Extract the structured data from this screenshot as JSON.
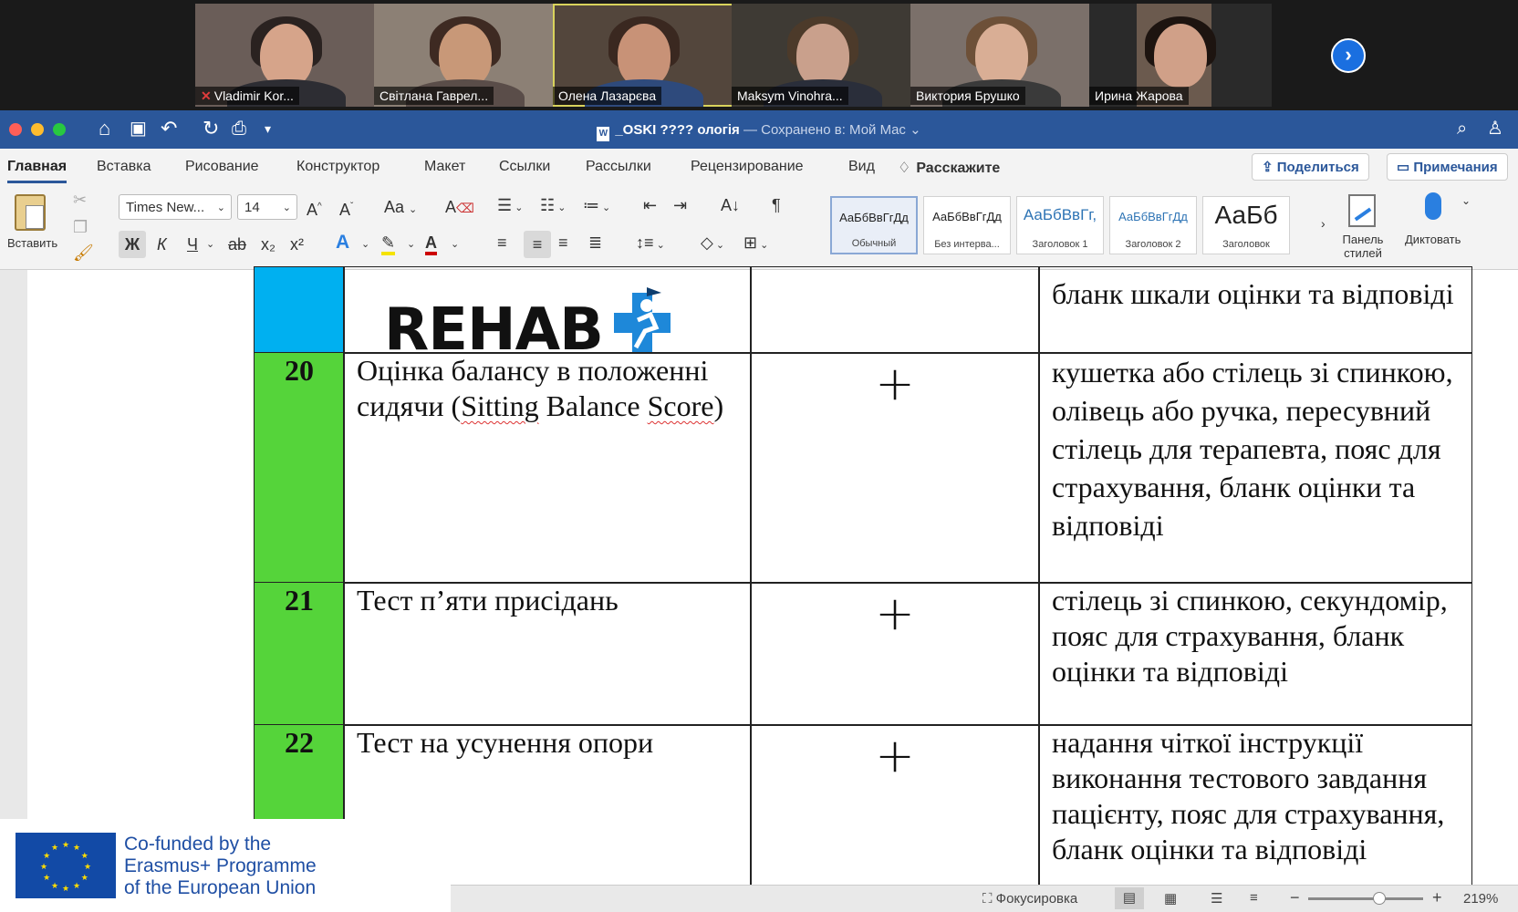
{
  "participants": [
    {
      "name": "Vladimir Kor...",
      "muted": true
    },
    {
      "name": "Світлана Гаврел...",
      "muted": false
    },
    {
      "name": "Олена Лазарєва",
      "muted": false,
      "active": true
    },
    {
      "name": "Maksym Vinohra...",
      "muted": false
    },
    {
      "name": "Виктория Брушко",
      "muted": false
    },
    {
      "name": "Ирина Жарова",
      "muted": false
    }
  ],
  "next_icon": "chevron-right-icon",
  "titlebar": {
    "doc_name": "_OSKI ???? ологія",
    "saved_text": " — Сохранено в: Мой Mac ⌄"
  },
  "tabs": [
    "Главная",
    "Вставка",
    "Рисование",
    "Конструктор",
    "Макет",
    "Ссылки",
    "Рассылки",
    "Рецензирование",
    "Вид",
    "Расскажите"
  ],
  "share_label": "Поделиться",
  "comments_label": "Примечания",
  "ribbon": {
    "paste_label": "Вставить",
    "font_name": "Times New...",
    "font_size": "14",
    "bold": "Ж",
    "italic": "К",
    "underline": "Ч",
    "strike": "ab",
    "sub": "x₂",
    "sup": "x²",
    "styles": [
      {
        "preview": "АаБбВвГгДд",
        "label": "Обычный",
        "selected": true
      },
      {
        "preview": "АаБбВвГгДд",
        "label": "Без интерва..."
      },
      {
        "preview": "АаБбВвГг,",
        "label": "Заголовок 1"
      },
      {
        "preview": "АаБбВвГгДд",
        "label": "Заголовок 2"
      },
      {
        "preview": "АаБб",
        "label": "Заголовок"
      }
    ],
    "styles_pane_label": "Панель стилей",
    "dictate_label": "Диктовать"
  },
  "document": {
    "watermark": "REHAB",
    "top_row_text": "бланк шкали оцінки та відповіді",
    "rows": [
      {
        "num": "20",
        "title_a": "Оцінка балансу в положенні сидячи (",
        "title_sq1": "Sitting",
        "title_b": " Balance ",
        "title_sq2": "Score",
        "title_c": ")",
        "mark": "+",
        "equipment": "кушетка або стілець зі спинкою, олівець або ручка, пересувний стілець для терапевта, пояс для страхування, бланк оцінки та відповіді"
      },
      {
        "num": "21",
        "title": "Тест п’яти присідань",
        "mark": "+",
        "equipment": "стілець зі спинкою, секундомір, пояс для страхування, бланк оцінки та відповіді"
      },
      {
        "num": "22",
        "title": "Тест на усунення опори",
        "mark": "+",
        "equipment": "надання чіткої інструкції виконання тестового завдання пацієнту, пояс для страхування, бланк оцінки та відповіді"
      }
    ]
  },
  "status": {
    "focus_label": "Фокусировка",
    "zoom": "219%",
    "zoom_level": 0.62
  },
  "eu": {
    "line1": "Co-funded by the",
    "line2": "Erasmus+ Programme",
    "line3": "of the European Union"
  },
  "colors": {
    "word_blue": "#2b579a",
    "green_col": "#55d43a",
    "cyan_col": "#00b0f0"
  }
}
